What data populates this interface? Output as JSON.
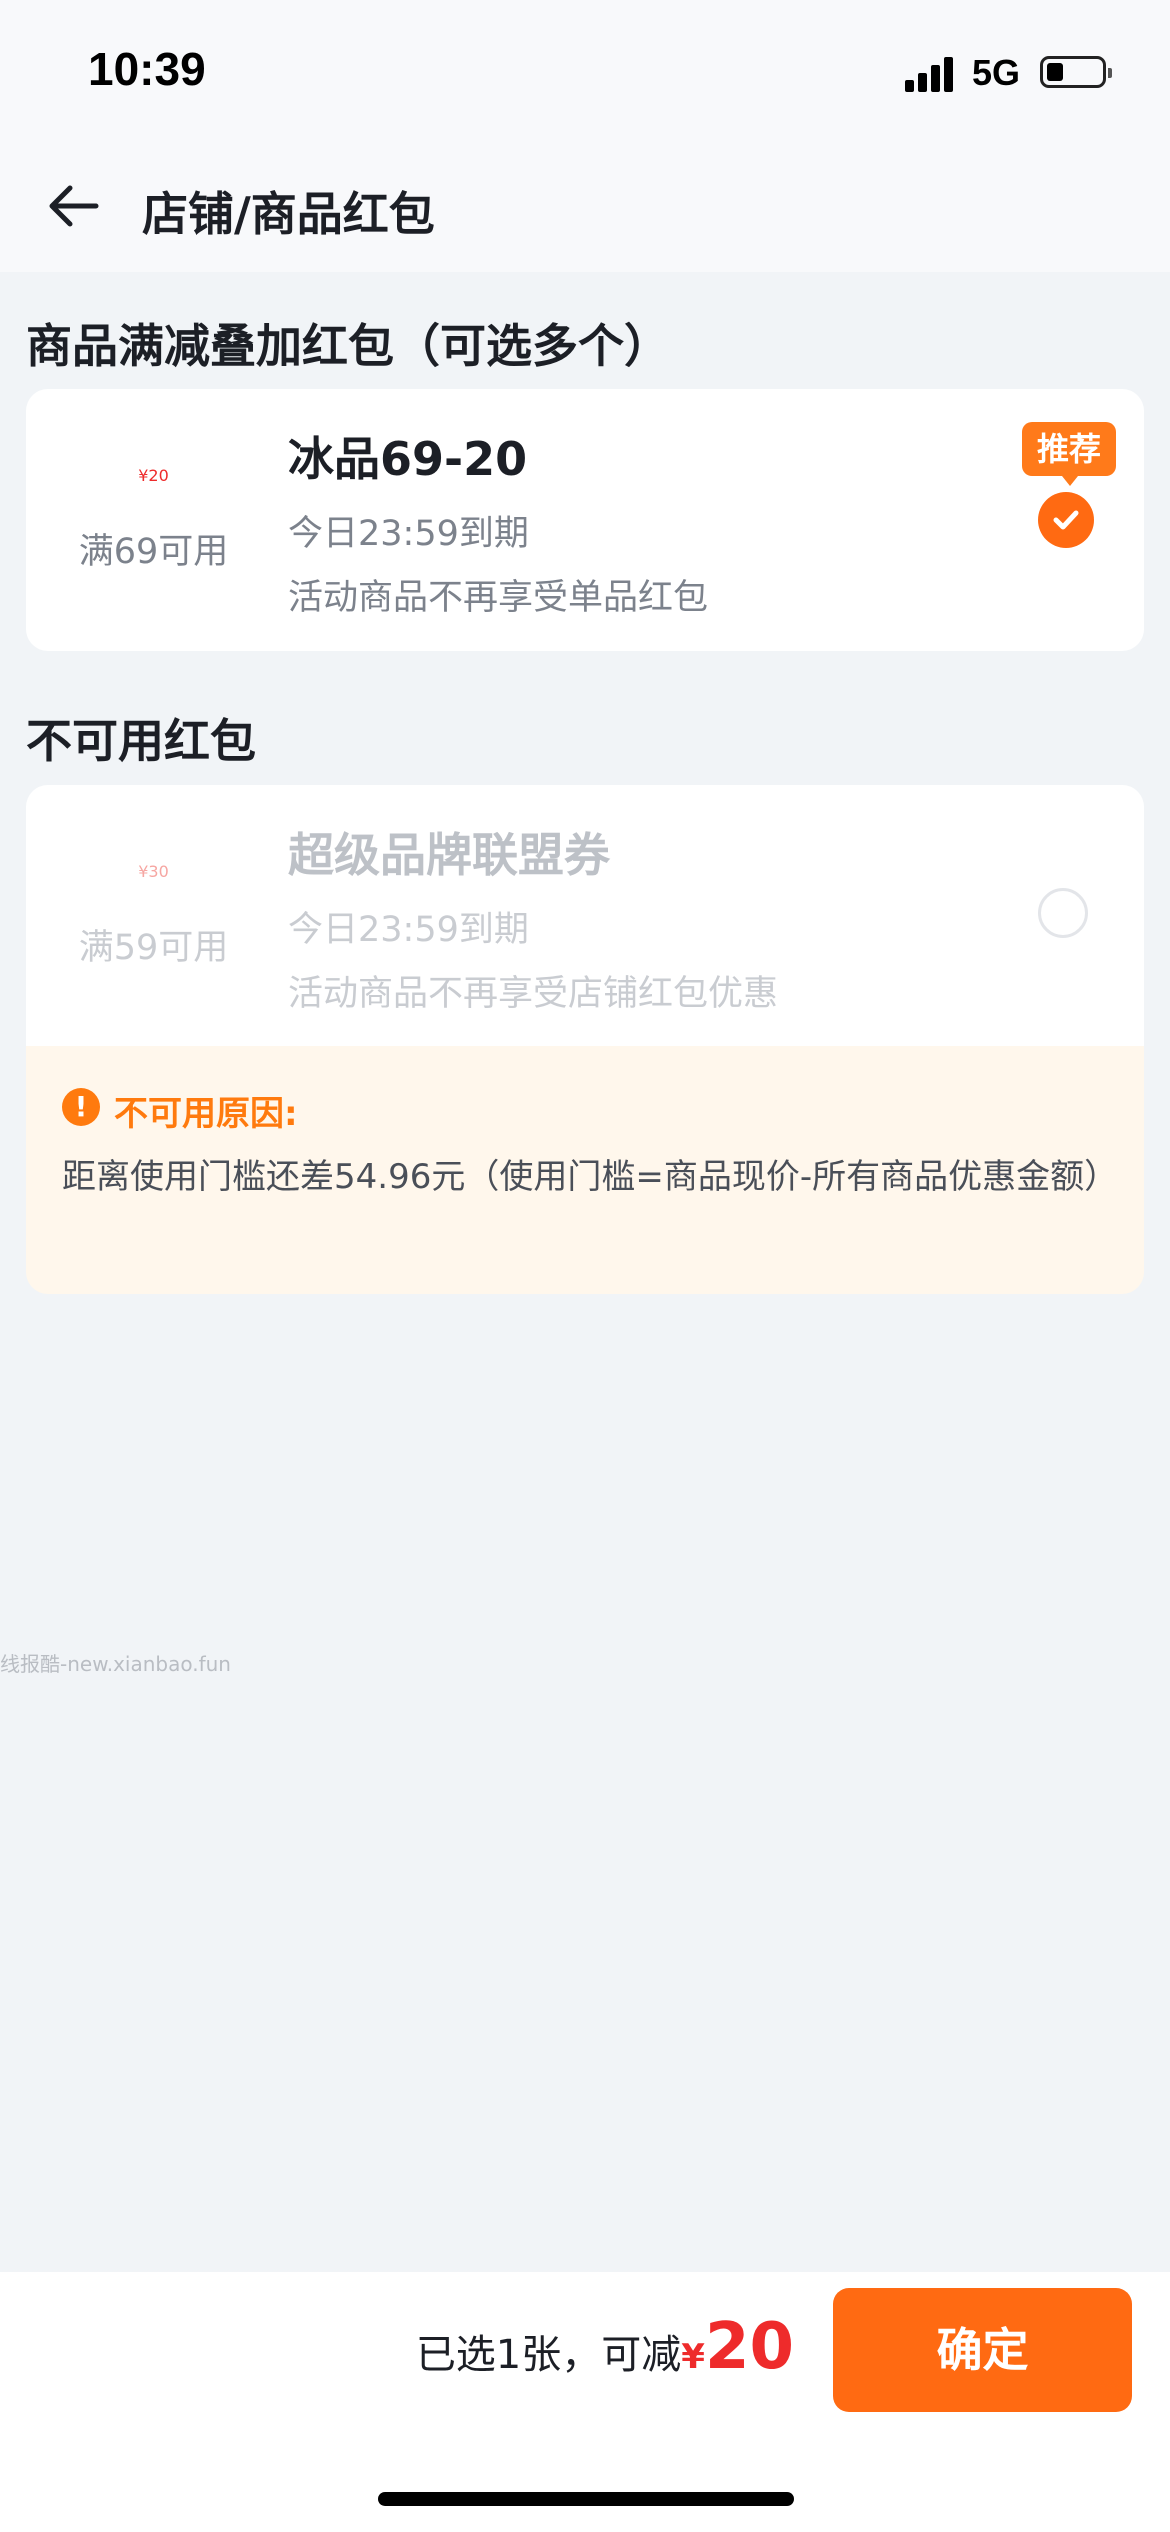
{
  "status_bar": {
    "time": "10:39",
    "network": "5G"
  },
  "header": {
    "title": "店铺/商品红包"
  },
  "available_section": {
    "title": "商品满减叠加红包（可选多个）",
    "coupons": [
      {
        "currency": "¥",
        "amount": "20",
        "threshold": "满69可用",
        "name": "冰品69-20",
        "expiry": "今日23:59到期",
        "note": "活动商品不再享受单品红包",
        "badge": "推荐",
        "selected": true
      }
    ]
  },
  "unavailable_section": {
    "title": "不可用红包",
    "coupons": [
      {
        "currency": "¥",
        "amount": "30",
        "threshold": "满59可用",
        "name": "超级品牌联盟券",
        "expiry": "今日23:59到期",
        "note": "活动商品不再享受店铺红包优惠",
        "selected": false,
        "reason_title": "不可用原因:",
        "reason_text": "距离使用门槛还差54.96元（使用门槛=商品现价-所有商品优惠金额）"
      }
    ]
  },
  "watermark": "线报酷-new.xianbao.fun",
  "footer": {
    "summary_text": "已选1张，可减",
    "currency": "¥",
    "discount": "20",
    "confirm_label": "确定"
  },
  "colors": {
    "accent": "#FF6A12",
    "price_red": "#EE2B2B",
    "background": "#F1F4F7"
  }
}
